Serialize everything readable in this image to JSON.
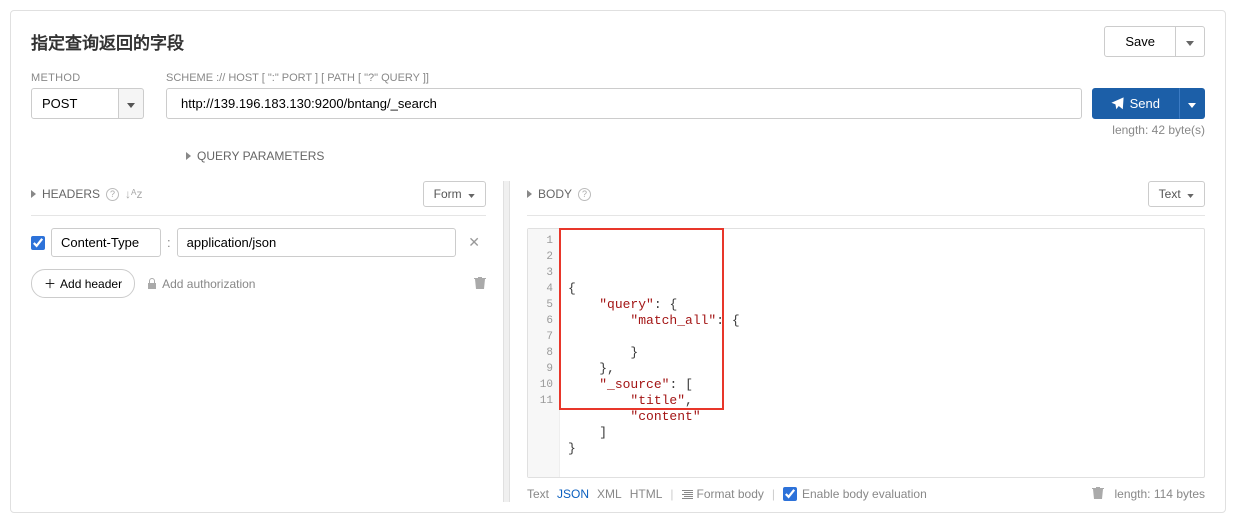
{
  "title": "指定查询返回的字段",
  "toolbar": {
    "save_label": "Save"
  },
  "method": {
    "label": "METHOD",
    "value": "POST"
  },
  "scheme": {
    "label": "SCHEME :// HOST [ \":\" PORT ] [ PATH [ \"?\" QUERY ]]",
    "value": "http://139.196.183.130:9200/bntang/_search",
    "length_text": "length: 42 byte(s)"
  },
  "send": {
    "label": "Send"
  },
  "query_params_label": "QUERY PARAMETERS",
  "headers": {
    "title": "HEADERS",
    "mode_button": "Form",
    "rows": [
      {
        "checked": true,
        "name": "Content-Type",
        "value": "application/json"
      }
    ],
    "add_header_label": "Add header",
    "add_auth_label": "Add authorization"
  },
  "body": {
    "title": "BODY",
    "mode_button": "Text",
    "code_lines": [
      "{",
      "    \"query\": {",
      "        \"match_all\": {",
      "",
      "        }",
      "    },",
      "    \"_source\": [",
      "        \"title\",",
      "        \"content\"",
      "    ]",
      "}"
    ],
    "footer": {
      "formats": {
        "text": "Text",
        "json": "JSON",
        "xml": "XML",
        "html": "HTML"
      },
      "format_body_label": "Format body",
      "enable_eval_label": "Enable body evaluation",
      "length_text": "length: 114 bytes"
    }
  }
}
